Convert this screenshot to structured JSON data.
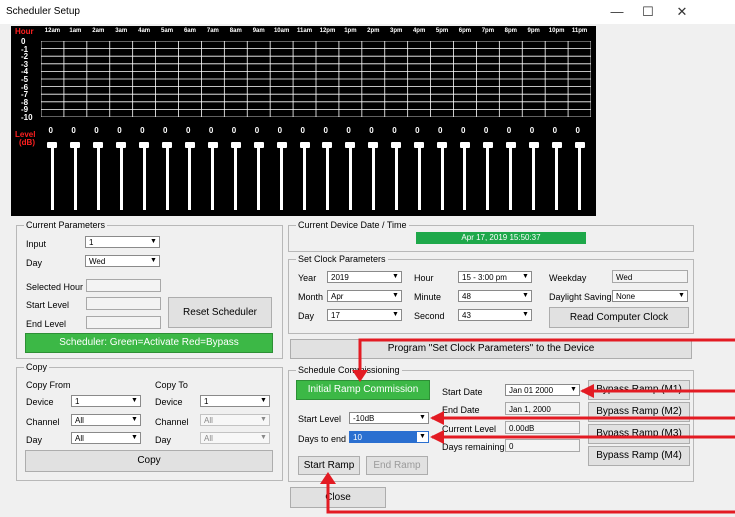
{
  "window": {
    "title": "Scheduler Setup",
    "minimize": "—",
    "maximize": "☐",
    "close": "✕"
  },
  "graph": {
    "hour_label": "Hour",
    "hours": [
      "12am",
      "1am",
      "2am",
      "3am",
      "4am",
      "5am",
      "6am",
      "7am",
      "8am",
      "9am",
      "10am",
      "11am",
      "12pm",
      "1pm",
      "2pm",
      "3pm",
      "4pm",
      "5pm",
      "6pm",
      "7pm",
      "8pm",
      "9pm",
      "10pm",
      "11pm"
    ],
    "y_ticks": [
      "0",
      "-1",
      "-2",
      "-3",
      "-4",
      "-5",
      "-6",
      "-7",
      "-8",
      "-9",
      "-10"
    ],
    "level_label": "Level",
    "db_label": "(dB)",
    "level_values": [
      "0",
      "0",
      "0",
      "0",
      "0",
      "0",
      "0",
      "0",
      "0",
      "0",
      "0",
      "0",
      "0",
      "0",
      "0",
      "0",
      "0",
      "0",
      "0",
      "0",
      "0",
      "0",
      "0",
      "0"
    ],
    "slider_levels_db": [
      0,
      0,
      0,
      0,
      0,
      0,
      0,
      0,
      0,
      0,
      0,
      0,
      0,
      0,
      0,
      0,
      0,
      0,
      0,
      0,
      0,
      0,
      0,
      0
    ],
    "colors": {
      "background": "#000000",
      "grid": "#ffffff",
      "hour_label": "#ff2020"
    }
  },
  "current_params": {
    "legend": "Current Parameters",
    "input_label": "Input",
    "input_value": "1",
    "day_label": "Day",
    "day_value": "Wed",
    "selected_hour_label": "Selected Hour",
    "selected_hour_value": "",
    "start_level_label": "Start Level",
    "start_level_value": "",
    "end_level_label": "End Level",
    "end_level_value": "",
    "reset_button": "Reset Scheduler",
    "status_bar": "Scheduler: Green=Activate Red=Bypass"
  },
  "device_time": {
    "legend": "Current Device Date / Time",
    "value": "Apr 17, 2019  15:50:37"
  },
  "set_clock": {
    "legend": "Set Clock Parameters",
    "year_label": "Year",
    "year_value": "2019",
    "month_label": "Month",
    "month_value": "Apr",
    "day_label": "Day",
    "day_value": "17",
    "hour_label": "Hour",
    "hour_value": "15 - 3:00 pm",
    "minute_label": "Minute",
    "minute_value": "48",
    "second_label": "Second",
    "second_value": "43",
    "weekday_label": "Weekday",
    "weekday_value": "Wed",
    "daylight_label": "Daylight Saving",
    "daylight_value": "None",
    "read_clock_button": "Read Computer Clock"
  },
  "program_button": "Program \"Set Clock Parameters\" to the Device",
  "copy": {
    "legend": "Copy",
    "from_label": "Copy From",
    "to_label": "Copy To",
    "device_label": "Device",
    "channel_label": "Channel",
    "day_label": "Day",
    "from_device": "1",
    "from_channel": "All",
    "from_day": "All",
    "to_device": "1",
    "to_channel": "All",
    "to_day": "All",
    "copy_button": "Copy"
  },
  "commission": {
    "legend": "Schedule Commissioning",
    "initial_ramp_button": "Initial Ramp Commission",
    "start_level_label": "Start Level",
    "start_level_value": "-10dB",
    "days_to_end_label": "Days to end",
    "days_to_end_value": "10",
    "start_date_label": "Start Date",
    "start_date_value": "Jan  01 2000",
    "end_date_label": "End Date",
    "end_date_value": "Jan 1, 2000",
    "current_level_label": "Current Level",
    "current_level_value": "0.00dB",
    "days_remaining_label": "Days remaining",
    "days_remaining_value": "0",
    "start_ramp_button": "Start Ramp",
    "end_ramp_button": "End Ramp",
    "bypass_m1": "Bypass Ramp (M1)",
    "bypass_m2": "Bypass Ramp (M2)",
    "bypass_m3": "Bypass Ramp (M3)",
    "bypass_m4": "Bypass Ramp (M4)"
  },
  "close_button": "Close"
}
